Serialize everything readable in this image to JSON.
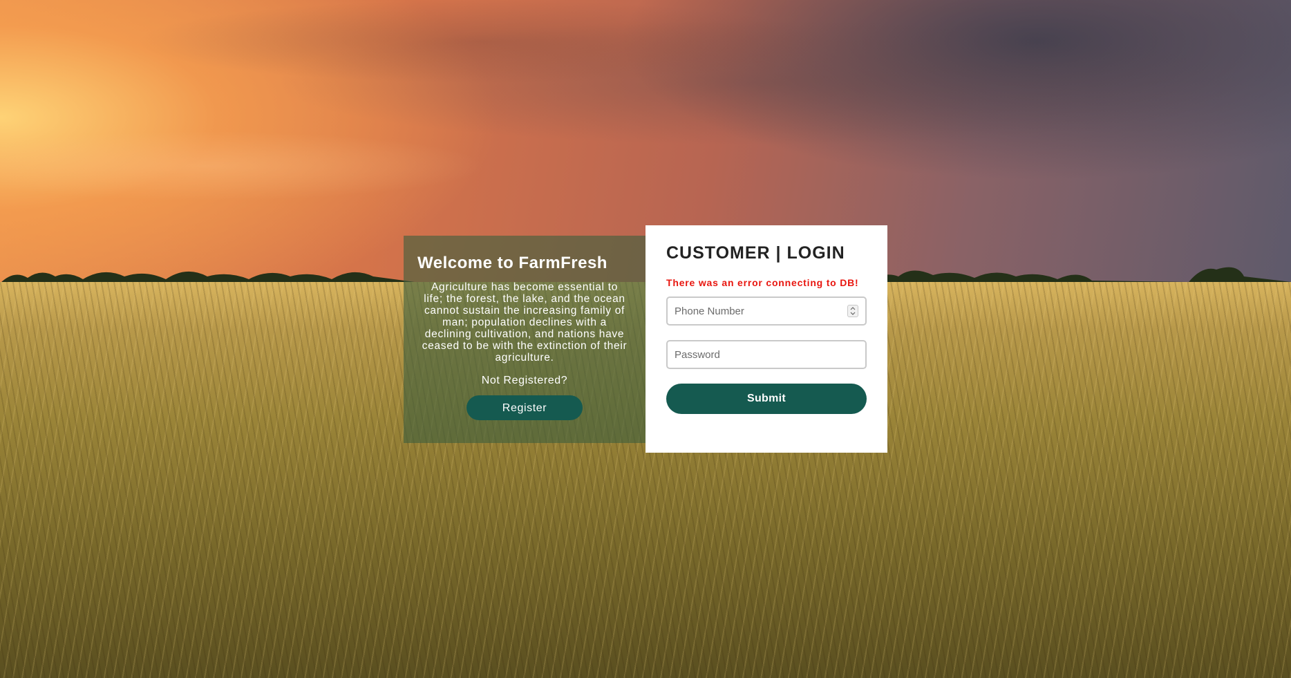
{
  "welcome": {
    "title": "Welcome to FarmFresh",
    "text": "Agriculture has become essential to life; the forest, the lake, and the ocean cannot sustain the increasing family of man; population declines with a declining cultivation, and nations have ceased to be with the extinction of their agriculture.",
    "question": "Not Registered?",
    "register_label": "Register"
  },
  "login": {
    "title": "CUSTOMER | LOGIN",
    "error": "There was an error connecting to DB!",
    "phone_placeholder": "Phone Number",
    "password_placeholder": "Password",
    "submit_label": "Submit"
  },
  "colors": {
    "accent": "#155a50",
    "error": "#e8160f",
    "welcome_panel": "#3f5f3e"
  },
  "icons": {
    "number_spinner": "up-down-chevron-icon"
  }
}
